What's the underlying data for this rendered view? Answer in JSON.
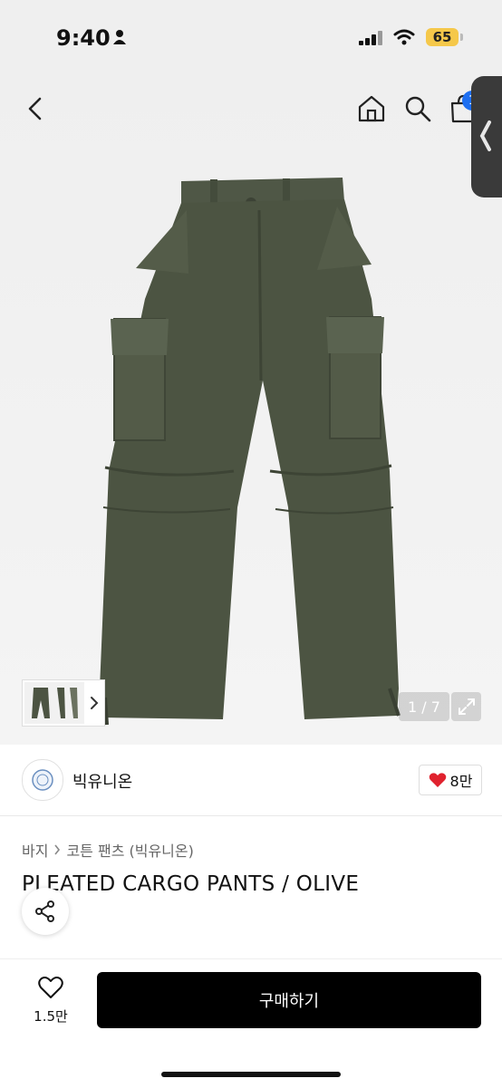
{
  "status": {
    "time": "9:40",
    "battery": "65"
  },
  "nav": {
    "cart_count": "1"
  },
  "gallery": {
    "counter": "1 / 7"
  },
  "brand": {
    "name": "빅유니온"
  },
  "like": {
    "count": "8만"
  },
  "breadcrumb": {
    "category": "바지",
    "subcategory": "코튼 팬츠 (빅유니온)"
  },
  "product": {
    "title": "PLEATED CARGO PANTS / OLIVE"
  },
  "bottom": {
    "wish_count": "1.5만",
    "buy_label": "구매하기"
  },
  "colors": {
    "accent": "#1e6ff1",
    "like_heart": "#e0222e",
    "pants_olive": "#4c5442",
    "button_black": "#000000"
  }
}
